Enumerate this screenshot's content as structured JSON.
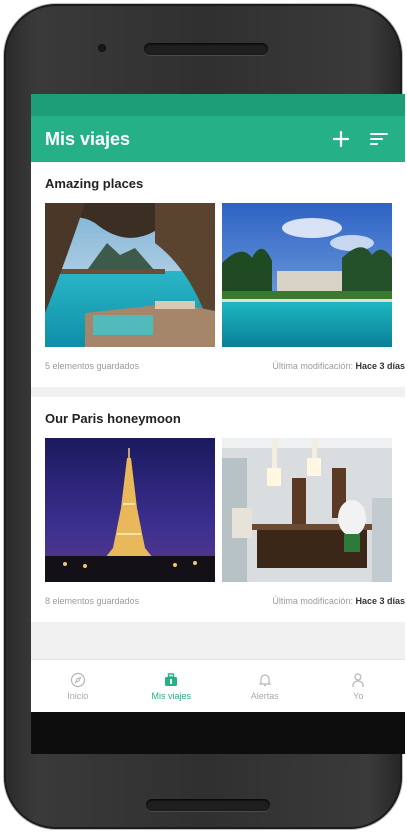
{
  "app": {
    "title": "Mis viajes",
    "accent": "#26b088",
    "status_bar_color": "#1e9e78"
  },
  "header_icons": [
    "plus-icon",
    "sort-icon"
  ],
  "trips": [
    {
      "title": "Amazing places",
      "saved": "5 elementos guardados",
      "modified_label": "Última modificación:",
      "modified_value": "Hace 3 días",
      "photos": [
        "overwater-bungalow-photo",
        "resort-pool-photo"
      ]
    },
    {
      "title": "Our Paris honeymoon",
      "saved": "8 elementos guardados",
      "modified_label": "Última modificación:",
      "modified_value": "Hace 3 días",
      "photos": [
        "eiffel-tower-night-photo",
        "hotel-lobby-photo"
      ]
    }
  ],
  "tabs": [
    {
      "label": "Inicio",
      "icon": "compass-icon",
      "active": false
    },
    {
      "label": "Mis viajes",
      "icon": "suitcase-icon",
      "active": true
    },
    {
      "label": "Alertas",
      "icon": "bell-icon",
      "active": false
    },
    {
      "label": "Yo",
      "icon": "person-icon",
      "active": false
    }
  ]
}
